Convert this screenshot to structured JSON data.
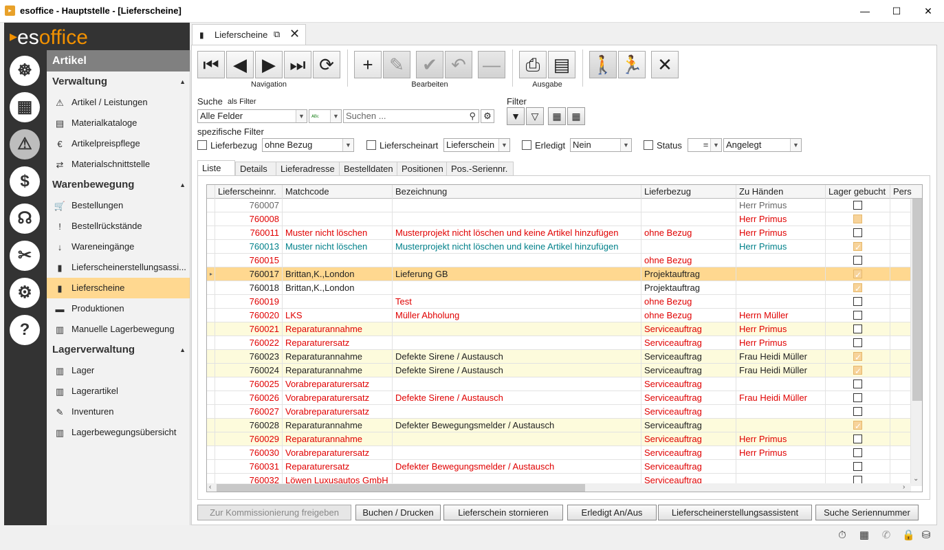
{
  "window": {
    "title": "esoffice - Hauptstelle - [Lieferscheine]",
    "app_icon": "app-icon",
    "controls": [
      "minimize",
      "maximize",
      "close"
    ]
  },
  "logo": {
    "part1": "es",
    "part2": "office"
  },
  "modules": [
    {
      "name": "dashboard",
      "icon": "helm-icon"
    },
    {
      "name": "projekte",
      "icon": "board-icon"
    },
    {
      "name": "artikel",
      "icon": "siren-icon",
      "active": true
    },
    {
      "name": "finanzen",
      "icon": "money-icon"
    },
    {
      "name": "service",
      "icon": "headset-icon"
    },
    {
      "name": "werkzeuge",
      "icon": "tools-icon"
    },
    {
      "name": "einstellungen",
      "icon": "gears-icon"
    },
    {
      "name": "hilfe",
      "icon": "question-icon"
    }
  ],
  "nav": {
    "module": "Artikel",
    "groups": [
      {
        "title": "Verwaltung",
        "items": [
          "Artikel / Leistungen",
          "Materialkataloge",
          "Artikelpreispflege",
          "Materialschnittstelle"
        ]
      },
      {
        "title": "Warenbewegung",
        "items": [
          "Bestellungen",
          "Bestellrückstände",
          "Wareneingänge",
          "Lieferscheinerstellungsassi...",
          "Lieferscheine",
          "Produktionen",
          "Manuelle Lagerbewegung"
        ]
      },
      {
        "title": "Lagerverwaltung",
        "items": [
          "Lager",
          "Lagerartikel",
          "Inventuren",
          "Lagerbewegungsübersicht"
        ]
      }
    ],
    "selected": "Lieferscheine"
  },
  "tab": {
    "title": "Lieferscheine"
  },
  "toolbar": {
    "groups": [
      "Navigation",
      "Bearbeiten",
      "Ausgabe"
    ]
  },
  "search": {
    "label": "Suche",
    "as_filter": "als Filter",
    "field": "Alle Felder",
    "placeholder": "Suchen ...",
    "filter_label": "Filter"
  },
  "specific": {
    "label": "spezifische Filter",
    "lieferbezug_label": "Lieferbezug",
    "lieferbezug_value": "ohne Bezug",
    "lieferscheinart_label": "Lieferscheinart",
    "lieferscheinart_value": "Lieferschein",
    "erledigt_label": "Erledigt",
    "erledigt_value": "Nein",
    "status_label": "Status",
    "status_op": "=",
    "status_value": "Angelegt"
  },
  "tabs": [
    "Liste",
    "Details",
    "Lieferadresse",
    "Bestelldaten",
    "Positionen",
    "Pos.-Seriennr."
  ],
  "grid": {
    "columns": [
      "Lieferscheinnr.",
      "Matchcode",
      "Bezeichnung",
      "Lieferbezug",
      "Zu Händen",
      "Lager gebucht",
      "Pers"
    ],
    "rows": [
      {
        "nr": "760007",
        "match": "",
        "bez": "",
        "bezug": "",
        "zh": "Herr Primus",
        "lager": "off",
        "style": "gray"
      },
      {
        "nr": "760008",
        "match": "",
        "bez": "",
        "bezug": "",
        "zh": "Herr Primus",
        "lager": "part",
        "style": "red"
      },
      {
        "nr": "760011",
        "match": "Muster nicht löschen",
        "bez": "Musterprojekt nicht löschen und keine Artikel hinzufügen",
        "bezug": "ohne Bezug",
        "zh": "Herr Primus",
        "lager": "off",
        "style": "red"
      },
      {
        "nr": "760013",
        "match": "Muster nicht löschen",
        "bez": "Musterprojekt nicht löschen und keine Artikel hinzufügen",
        "bezug": "",
        "zh": "Herr Primus",
        "lager": "on",
        "style": "teal"
      },
      {
        "nr": "760015",
        "match": "",
        "bez": "",
        "bezug": "ohne Bezug",
        "zh": "",
        "lager": "off",
        "style": "red"
      },
      {
        "nr": "760017",
        "match": "Brittan,K.,London",
        "bez": "Lieferung GB",
        "bezug": "Projektauftrag",
        "zh": "",
        "lager": "on",
        "style": "selected"
      },
      {
        "nr": "760018",
        "match": "Brittan,K.,London",
        "bez": "",
        "bezug": "Projektauftrag",
        "zh": "",
        "lager": "on",
        "style": "dark"
      },
      {
        "nr": "760019",
        "match": "",
        "bez": "Test",
        "bezug": "ohne Bezug",
        "zh": "",
        "lager": "off",
        "style": "red"
      },
      {
        "nr": "760020",
        "match": "LKS",
        "bez": "Müller Abholung",
        "bezug": "ohne Bezug",
        "zh": "Herrn Müller",
        "lager": "off",
        "style": "red"
      },
      {
        "nr": "760021",
        "match": "Reparaturannahme",
        "bez": "",
        "bezug": "Serviceauftrag",
        "zh": "Herr Primus",
        "lager": "off",
        "style": "redyellow"
      },
      {
        "nr": "760022",
        "match": "Reparaturersatz",
        "bez": "",
        "bezug": "Serviceauftrag",
        "zh": "Herr Primus",
        "lager": "off",
        "style": "red"
      },
      {
        "nr": "760023",
        "match": "Reparaturannahme",
        "bez": "Defekte Sirene / Austausch",
        "bezug": "Serviceauftrag",
        "zh": "Frau Heidi Müller",
        "lager": "on",
        "style": "darkyellow"
      },
      {
        "nr": "760024",
        "match": "Reparaturannahme",
        "bez": "Defekte Sirene / Austausch",
        "bezug": "Serviceauftrag",
        "zh": "Frau Heidi Müller",
        "lager": "on",
        "style": "darkyellow"
      },
      {
        "nr": "760025",
        "match": "Vorabreparaturersatz",
        "bez": "",
        "bezug": "Serviceauftrag",
        "zh": "",
        "lager": "off",
        "style": "red"
      },
      {
        "nr": "760026",
        "match": "Vorabreparaturersatz",
        "bez": "Defekte Sirene / Austausch",
        "bezug": "Serviceauftrag",
        "zh": "Frau Heidi Müller",
        "lager": "off",
        "style": "red"
      },
      {
        "nr": "760027",
        "match": "Vorabreparaturersatz",
        "bez": "",
        "bezug": "Serviceauftrag",
        "zh": "",
        "lager": "off",
        "style": "red"
      },
      {
        "nr": "760028",
        "match": "Reparaturannahme",
        "bez": "Defekter Bewegungsmelder / Austausch",
        "bezug": "Serviceauftrag",
        "zh": "",
        "lager": "on",
        "style": "darkyellow"
      },
      {
        "nr": "760029",
        "match": "Reparaturannahme",
        "bez": "",
        "bezug": "Serviceauftrag",
        "zh": "Herr Primus",
        "lager": "off",
        "style": "redyellow"
      },
      {
        "nr": "760030",
        "match": "Vorabreparaturersatz",
        "bez": "",
        "bezug": "Serviceauftrag",
        "zh": "Herr Primus",
        "lager": "off",
        "style": "red"
      },
      {
        "nr": "760031",
        "match": "Reparaturersatz",
        "bez": "Defekter Bewegungsmelder / Austausch",
        "bezug": "Serviceauftrag",
        "zh": "",
        "lager": "off",
        "style": "red"
      },
      {
        "nr": "760032",
        "match": "Löwen Luxusautos GmbH",
        "bez": "",
        "bezug": "Serviceauftrag",
        "zh": "",
        "lager": "off",
        "style": "red"
      }
    ]
  },
  "actions": [
    {
      "label": "Zur Kommissionierung freigeben",
      "disabled": true
    },
    {
      "label": "Buchen / Drucken"
    },
    {
      "label": "Lieferschein stornieren"
    },
    {
      "label": "Erledigt An/Aus"
    },
    {
      "label": "Lieferscheinerstellungsassistent"
    },
    {
      "label": "Suche Seriennummer"
    }
  ],
  "colors": {
    "red": "#e00000",
    "teal": "#00808a",
    "gray": "#666666",
    "dark": "#222222",
    "selected_bg": "#ffd890",
    "yellow_bg": "#fdfbdc",
    "accent": "#f29100"
  }
}
